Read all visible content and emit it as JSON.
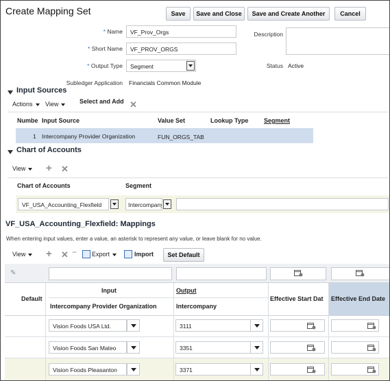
{
  "header": {
    "title": "Create Mapping Set",
    "buttons": {
      "save": "Save",
      "save_close": "Save and Close",
      "save_create": "Save and Create Another",
      "cancel": "Cancel"
    }
  },
  "form": {
    "name_label": "Name",
    "name_value": "VF_Prov_Orgs",
    "short_name_label": "Short Name",
    "short_name_value": "VF_PROV_ORGS",
    "output_type_label": "Output Type",
    "output_type_value": "Segment",
    "subledger_label": "Subledger Application",
    "subledger_value": "Financials Common Module",
    "description_label": "Description",
    "description_value": "",
    "status_label": "Status",
    "status_value": "Active",
    "required_mark": "*"
  },
  "input_sources": {
    "title": "Input Sources",
    "toolbar": {
      "actions": "Actions",
      "view": "View",
      "select_add": "Select and Add"
    },
    "columns": [
      "Numbe",
      "Input Source",
      "Value Set",
      "Lookup Type",
      "Segment"
    ],
    "rows": [
      {
        "num": "1",
        "input_source": "Intercompany Provider Organization",
        "value_set": "FUN_ORGS_TAB",
        "lookup_type": "",
        "segment": ""
      }
    ]
  },
  "chart_of_accounts": {
    "title": "Chart of Accounts",
    "toolbar": {
      "view": "View"
    },
    "columns": [
      "Chart of Accounts",
      "Segment"
    ],
    "row": {
      "coa": "VF_USA_Accounting_Flexfield",
      "segment": "Intercompany"
    }
  },
  "mappings": {
    "title": "VF_USA_Accounting_Flexfield: Mappings",
    "hint": "When entering input values, enter a value, an asterisk to represent any value, or leave blank for no value.",
    "toolbar": {
      "view": "View",
      "export": "Export",
      "import": "Import",
      "set_default": "Set Default"
    },
    "headers": {
      "default": "Default",
      "input": "Input",
      "input_sub": "Intercompany Provider Organization",
      "output": "Output",
      "output_sub": "Intercompany",
      "start_date": "Effective Start Dat",
      "end_date": "Effective End Date"
    },
    "rows": [
      {
        "input": "Vision Foods USA Ltd.",
        "output": "3111"
      },
      {
        "input": "Vision Foods San Mateo",
        "output": "3351"
      },
      {
        "input": "Vision Foods Pleasanton",
        "output": "3371"
      }
    ]
  },
  "colors": {
    "selected_row": "#cfdced",
    "header_blue": "#c8d6e6",
    "row_alt": "#f5f5e6",
    "accent": "#3a6fbd"
  }
}
